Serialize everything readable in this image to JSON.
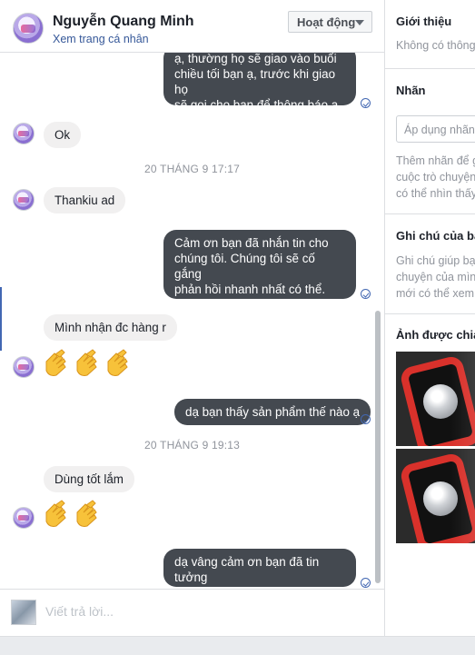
{
  "header": {
    "name": "Nguyễn Quang Minh",
    "profile_link": "Xem trang cá nhân",
    "status": "Hoạt động"
  },
  "messages": {
    "out_1": "ạ, thường họ sẽ giao vào buổi\nchiều tối bạn ạ, trước khi giao họ\nsẽ gọi cho bạn để thông báo ạ.",
    "in_1": "Ok",
    "time_1": "20 THÁNG 9 17:17",
    "in_2": "Thankiu ad",
    "out_2": "Cảm ơn bạn đã nhắn tin cho\nchúng tôi. Chúng tôi sẽ cố gắng\nphản hồi nhanh nhất có thể.\nChúng tôi sẽ sớm trả lời bạn.",
    "in_3": "Mình nhận đc hàng r",
    "out_3": "dạ bạn thấy sản phẩm thế nào ạ",
    "time_2": "20 THÁNG 9 19:13",
    "in_4": "Dùng tốt lắm",
    "out_4": "dạ vâng cảm ơn bạn đã tin tưởng\nvà ủng hộ cửa hàng ạ"
  },
  "composer": {
    "placeholder": "Viết trả lời..."
  },
  "right_panel": {
    "intro_title": "Giới thiệu",
    "intro_text": "Không có thông",
    "labels_title": "Nhãn",
    "labels_input": "Áp dụng nhãn...",
    "labels_help": "Thêm nhãn để g\ncuộc trò chuyện\ncó thể nhìn thấy",
    "notes_title": "Ghi chú của bạn",
    "notes_text": "Ghi chú giúp bạn\nchuyện của mìn\nmới có thể xem",
    "shared_title": "Ảnh được chia s"
  },
  "icons": {
    "seen": "seen-check-icon",
    "clap": "clapping-hands-emoji"
  },
  "colors": {
    "outgoing_bubble": "#444950",
    "incoming_bubble": "#f1f0f0",
    "link": "#365899",
    "accent": "#4267b2"
  }
}
